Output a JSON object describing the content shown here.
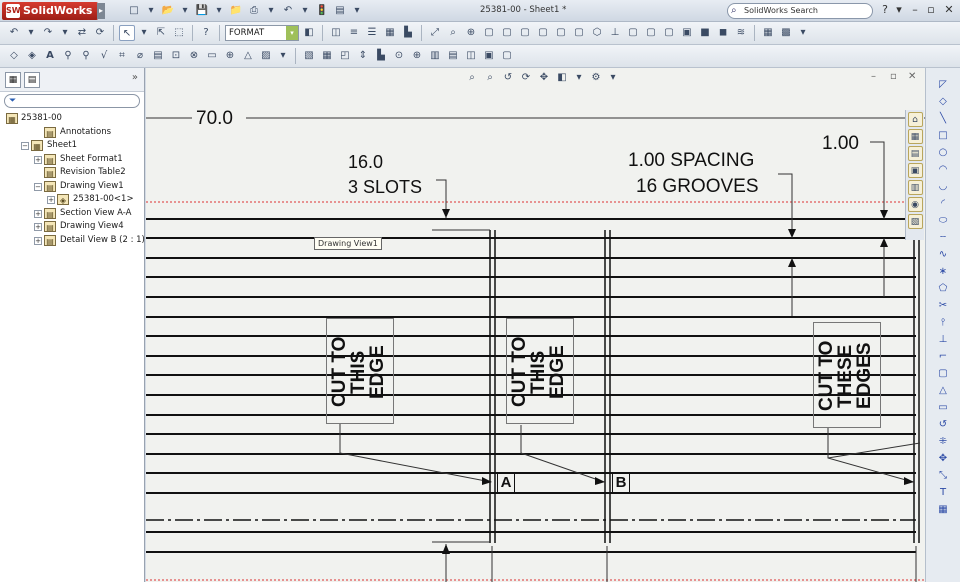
{
  "app": {
    "name": "SolidWorks",
    "doc_title": "25381-00 - Sheet1 *"
  },
  "search": {
    "placeholder": "SolidWorks Search"
  },
  "toolbar": {
    "format_value": "FORMAT"
  },
  "tree": {
    "root": "25381-00",
    "items": [
      {
        "label": "Annotations",
        "level": 1,
        "expand": ""
      },
      {
        "label": "Sheet1",
        "level": 0,
        "expand": "−"
      },
      {
        "label": "Sheet Format1",
        "level": 1,
        "expand": "+"
      },
      {
        "label": "Revision Table2",
        "level": 1,
        "expand": ""
      },
      {
        "label": "Drawing View1",
        "level": 1,
        "expand": "−"
      },
      {
        "label": "25381-00<1>",
        "level": 2,
        "expand": "+"
      },
      {
        "label": "Section View A-A",
        "level": 1,
        "expand": "+"
      },
      {
        "label": "Drawing View4",
        "level": 1,
        "expand": "+"
      },
      {
        "label": "Detail View B (2 : 1)",
        "level": 1,
        "expand": "+"
      }
    ]
  },
  "drawing": {
    "dim_overall": "70.0",
    "slots_dim": "16.0",
    "slots_count": "3 SLOTS",
    "spacing": "1.00 SPACING",
    "grooves": "16 GROOVES",
    "dim_right": "1.00",
    "note_1": [
      "CUT TO",
      "THIS",
      "EDGE"
    ],
    "note_2": [
      "CUT TO",
      "THIS",
      "EDGE"
    ],
    "note_3": [
      "CUT TO",
      "THESE",
      "EDGES"
    ],
    "label_a": "A",
    "label_b": "B",
    "tooltip": "Drawing View1"
  },
  "icons": {
    "colors": {
      "brand": "#b0241a",
      "accent": "#2b5fb3"
    }
  }
}
